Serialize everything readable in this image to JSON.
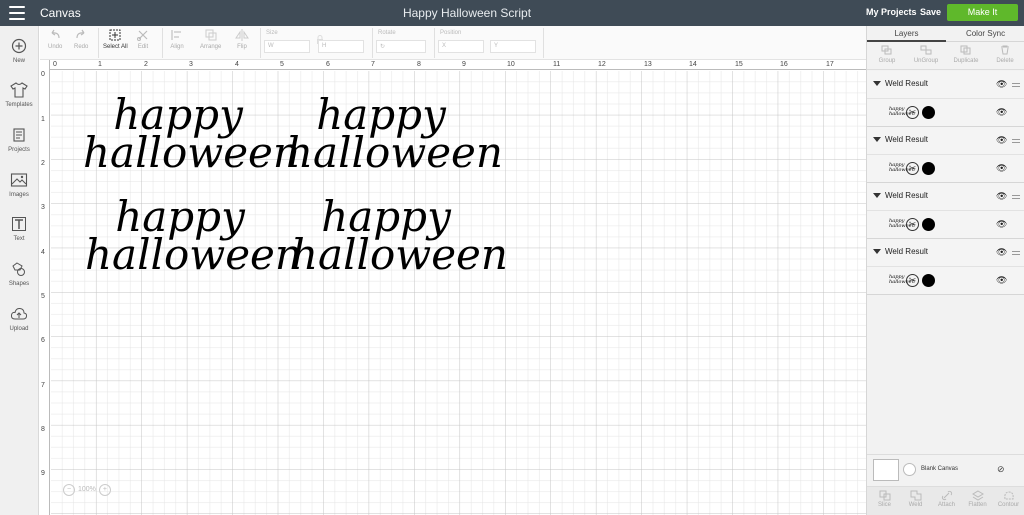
{
  "app": {
    "name": "Canvas",
    "document_title": "Happy Halloween Script",
    "my_projects": "My Projects",
    "save": "Save",
    "make_it": "Make It",
    "accent_color": "#5fb82b"
  },
  "leftnav": [
    {
      "label": "New",
      "icon": "plus-circle-icon"
    },
    {
      "label": "Templates",
      "icon": "shirt-icon"
    },
    {
      "label": "Projects",
      "icon": "folder-icon"
    },
    {
      "label": "Images",
      "icon": "image-icon"
    },
    {
      "label": "Text",
      "icon": "text-icon"
    },
    {
      "label": "Shapes",
      "icon": "shapes-icon"
    },
    {
      "label": "Upload",
      "icon": "cloud-upload-icon"
    }
  ],
  "toolbar": {
    "undo": "Undo",
    "redo": "Redo",
    "select_all": "Select All",
    "edit": "Edit",
    "align": "Align",
    "arrange": "Arrange",
    "flip": "Flip",
    "size": "Size",
    "w": "W",
    "h": "H",
    "rotate": "Rotate",
    "position": "Position",
    "x": "X",
    "y": "Y"
  },
  "canvas": {
    "ruler_top": [
      "0",
      "1",
      "2",
      "3",
      "4",
      "5",
      "6",
      "7",
      "8",
      "9",
      "10",
      "11",
      "12",
      "13",
      "14",
      "15",
      "16",
      "17"
    ],
    "ruler_left": [
      "0",
      "1",
      "2",
      "3",
      "4",
      "5",
      "6",
      "7",
      "8",
      "9"
    ],
    "designs": [
      {
        "line1": "happy",
        "line2": "halloween"
      },
      {
        "line1": "happy",
        "line2": "halloween"
      },
      {
        "line1": "happy",
        "line2": "halloween"
      },
      {
        "line1": "happy",
        "line2": "halloween"
      }
    ],
    "zoom": "100%"
  },
  "rightpanel": {
    "tab_layers": "Layers",
    "tab_color_sync": "Color Sync",
    "actions": [
      "Group",
      "UnGroup",
      "Duplicate",
      "Delete"
    ],
    "layers": [
      {
        "name": "Weld Result",
        "thumb1": "happy",
        "thumb2": "halloween",
        "color": "#000000"
      },
      {
        "name": "Weld Result",
        "thumb1": "happy",
        "thumb2": "halloween",
        "color": "#000000"
      },
      {
        "name": "Weld Result",
        "thumb1": "happy",
        "thumb2": "halloween",
        "color": "#000000"
      },
      {
        "name": "Weld Result",
        "thumb1": "happy",
        "thumb2": "halloween",
        "color": "#000000"
      }
    ],
    "blank_canvas": "Blank Canvas",
    "bottom_actions": [
      "Slice",
      "Weld",
      "Attach",
      "Flatten",
      "Contour"
    ]
  }
}
